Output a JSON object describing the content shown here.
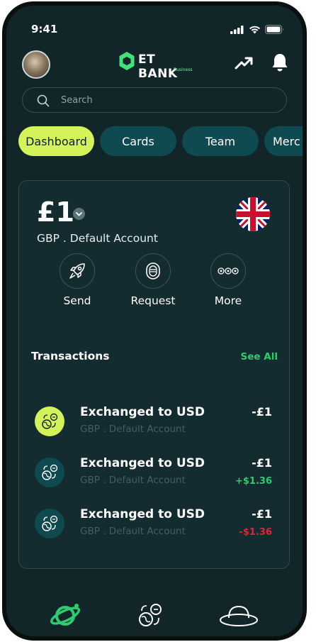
{
  "status_bar": {
    "time": "9:41"
  },
  "brand": {
    "name": "ET BANK",
    "tagline": "Business"
  },
  "search": {
    "placeholder": "Search"
  },
  "tabs": [
    {
      "label": "Dashboard",
      "active": true
    },
    {
      "label": "Cards",
      "active": false
    },
    {
      "label": "Team",
      "active": false
    },
    {
      "label": "Merc",
      "active": false
    }
  ],
  "account": {
    "balance": "£1",
    "label": "GBP . Default Account",
    "flag": "uk-flag"
  },
  "actions": [
    {
      "label": "Send",
      "icon": "rocket-icon"
    },
    {
      "label": "Request",
      "icon": "request-icon"
    },
    {
      "label": "More",
      "icon": "more-icon"
    }
  ],
  "transactions": {
    "title": "Transactions",
    "see_all": "See All",
    "items": [
      {
        "name": "Exchanged to USD",
        "account": "GBP . Default Account",
        "amount": "-£1",
        "fx": ""
      },
      {
        "name": "Exchanged to USD",
        "account": "GBP . Default Account",
        "amount": "-£1",
        "fx": "+$1.36"
      },
      {
        "name": "Exchanged to USD",
        "account": "GBP . Default Account",
        "amount": "-£1",
        "fx": "-$1.36"
      }
    ]
  },
  "colors": {
    "accent": "#d4f35a",
    "positive": "#2ecc71",
    "negative": "#e0243a",
    "background": "#12262a",
    "brand": "#3ee37a"
  },
  "bottom_nav": [
    {
      "icon": "planet-icon",
      "active": true
    },
    {
      "icon": "exchange-icon",
      "active": false
    },
    {
      "icon": "ufo-icon",
      "active": false
    }
  ]
}
